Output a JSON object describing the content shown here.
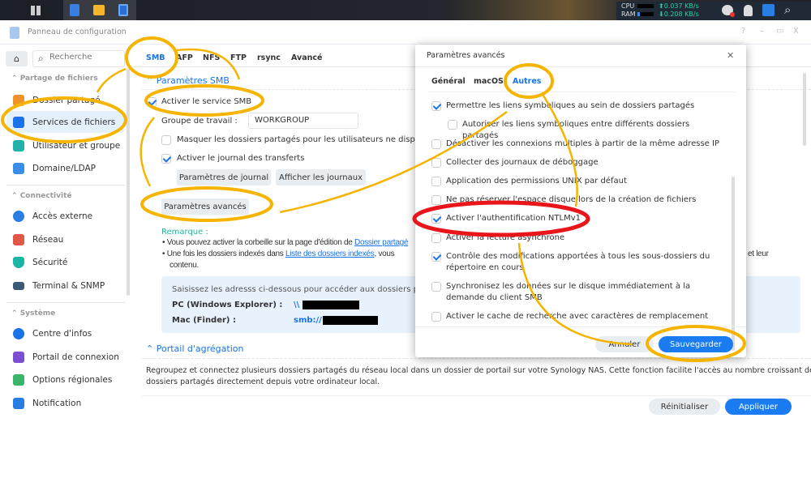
{
  "taskbar": {
    "cpu_label": "CPU",
    "ram_label": "RAM",
    "upload": "⬆0.037 KB/s",
    "download": "⬇0.208 KB/s"
  },
  "window": {
    "title": "Panneau de configuration",
    "controls": [
      "?",
      "–",
      "▭",
      "X"
    ]
  },
  "sidebar": {
    "search_placeholder": "Recherche",
    "sections": [
      {
        "title": "Partage de fichiers",
        "items": [
          {
            "label": "Dossier partagé",
            "color": "#f0922b"
          },
          {
            "label": "Services de fichiers",
            "color": "#1a73e8",
            "active": true
          },
          {
            "label": "Utilisateur et groupe",
            "color": "#20b2aa"
          },
          {
            "label": "Domaine/LDAP",
            "color": "#3a8ee6"
          }
        ]
      },
      {
        "title": "Connectivité",
        "items": [
          {
            "label": "Accès externe",
            "color": "#2a7de1"
          },
          {
            "label": "Réseau",
            "color": "#e0584a"
          },
          {
            "label": "Sécurité",
            "color": "#1cb5a6"
          },
          {
            "label": "Terminal & SNMP",
            "color": "#3b5a78"
          }
        ]
      },
      {
        "title": "Système",
        "items": [
          {
            "label": "Centre d'infos",
            "color": "#1a73e8"
          },
          {
            "label": "Portail de connexion",
            "color": "#7b4fd0"
          },
          {
            "label": "Options régionales",
            "color": "#3bb56a"
          },
          {
            "label": "Notification",
            "color": "#2a7de1"
          }
        ]
      }
    ]
  },
  "tabs": [
    "SMB",
    "AFP",
    "NFS",
    "FTP",
    "rsync",
    "Avancé"
  ],
  "smb": {
    "section_title": "Paramètres SMB",
    "enable_label": "Activer le service SMB",
    "workgroup_label": "Groupe de travail :",
    "workgroup_value": "WORKGROUP",
    "hide_label": "Masquer les dossiers partagés pour les utilisateurs ne disposant pas",
    "log_label": "Activer le journal des transferts",
    "log_settings_btn": "Paramètres de journal",
    "show_logs_btn": "Afficher les journaux",
    "advanced_btn": "Paramètres avancés",
    "remark_title": "Remarque :",
    "bullet1_text": "Vous pouvez activer la corbeille sur la page d'édition de ",
    "bullet1_link": "Dossier partagé",
    "bullet2_text": "Une fois les dossiers indexés dans ",
    "bullet2_link": "Liste des dossiers indexés",
    "bullet2_after": ", vous",
    "bullet2_end": "et leur",
    "bullet2_line2": "contenu.",
    "access_intro": "Saisissez les adresss ci-dessous pour accéder aux dossiers partagés",
    "pc_label": "PC (Windows Explorer) :",
    "pc_value": "\\\\",
    "mac_label": "Mac (Finder) :",
    "mac_value": "smb://"
  },
  "portal": {
    "title": "Portail d'agrégation",
    "desc_line1": "Regroupez et connectez plusieurs dossiers partagés du réseau local dans un dossier de portail sur votre Synology NAS. Cette fonction facilite l'accès au nombre croissant de",
    "desc_line2": "dossiers partagés directement depuis votre ordinateur local."
  },
  "footer": {
    "reset": "Réinitialiser",
    "apply": "Appliquer"
  },
  "modal": {
    "title": "Paramètres avancés",
    "close": "✕",
    "tabs": [
      "Général",
      "macOS",
      "Autres"
    ],
    "active_tab": "Autres",
    "options": [
      {
        "label": "Permettre les liens symboliques au sein de dossiers partagés",
        "checked": true
      },
      {
        "label": "Autoriser les liens symboliques entre différents dossiers partagés",
        "checked": false
      },
      {
        "label": "Désactiver les connexions multiples à partir de la même adresse IP",
        "checked": false
      },
      {
        "label": "Collecter des journaux de déboggage",
        "checked": false
      },
      {
        "label": "Application des permissions UNIX par défaut",
        "checked": false
      },
      {
        "label": "Ne pas réserver l'espace disque lors de la création de fichiers",
        "checked": false
      },
      {
        "label": "Activer l'authentification NTLMv1",
        "checked": true
      },
      {
        "label": "Activer la lecture asynchrone",
        "checked": false
      },
      {
        "label": "Contrôle des modifications apportées à tous les sous-dossiers du répertoire en cours",
        "checked": true
      },
      {
        "label": "Synchronisez les données sur le disque immédiatement à la demande du client SMB",
        "checked": false
      },
      {
        "label": "Activer le cache de recherche avec caractères de remplacement",
        "checked": false
      }
    ],
    "cancel": "Annuler",
    "save": "Sauvegarder"
  },
  "colors": {
    "accent": "#1a73e8",
    "highlight": "#f5b400",
    "alert": "#e8161b"
  }
}
